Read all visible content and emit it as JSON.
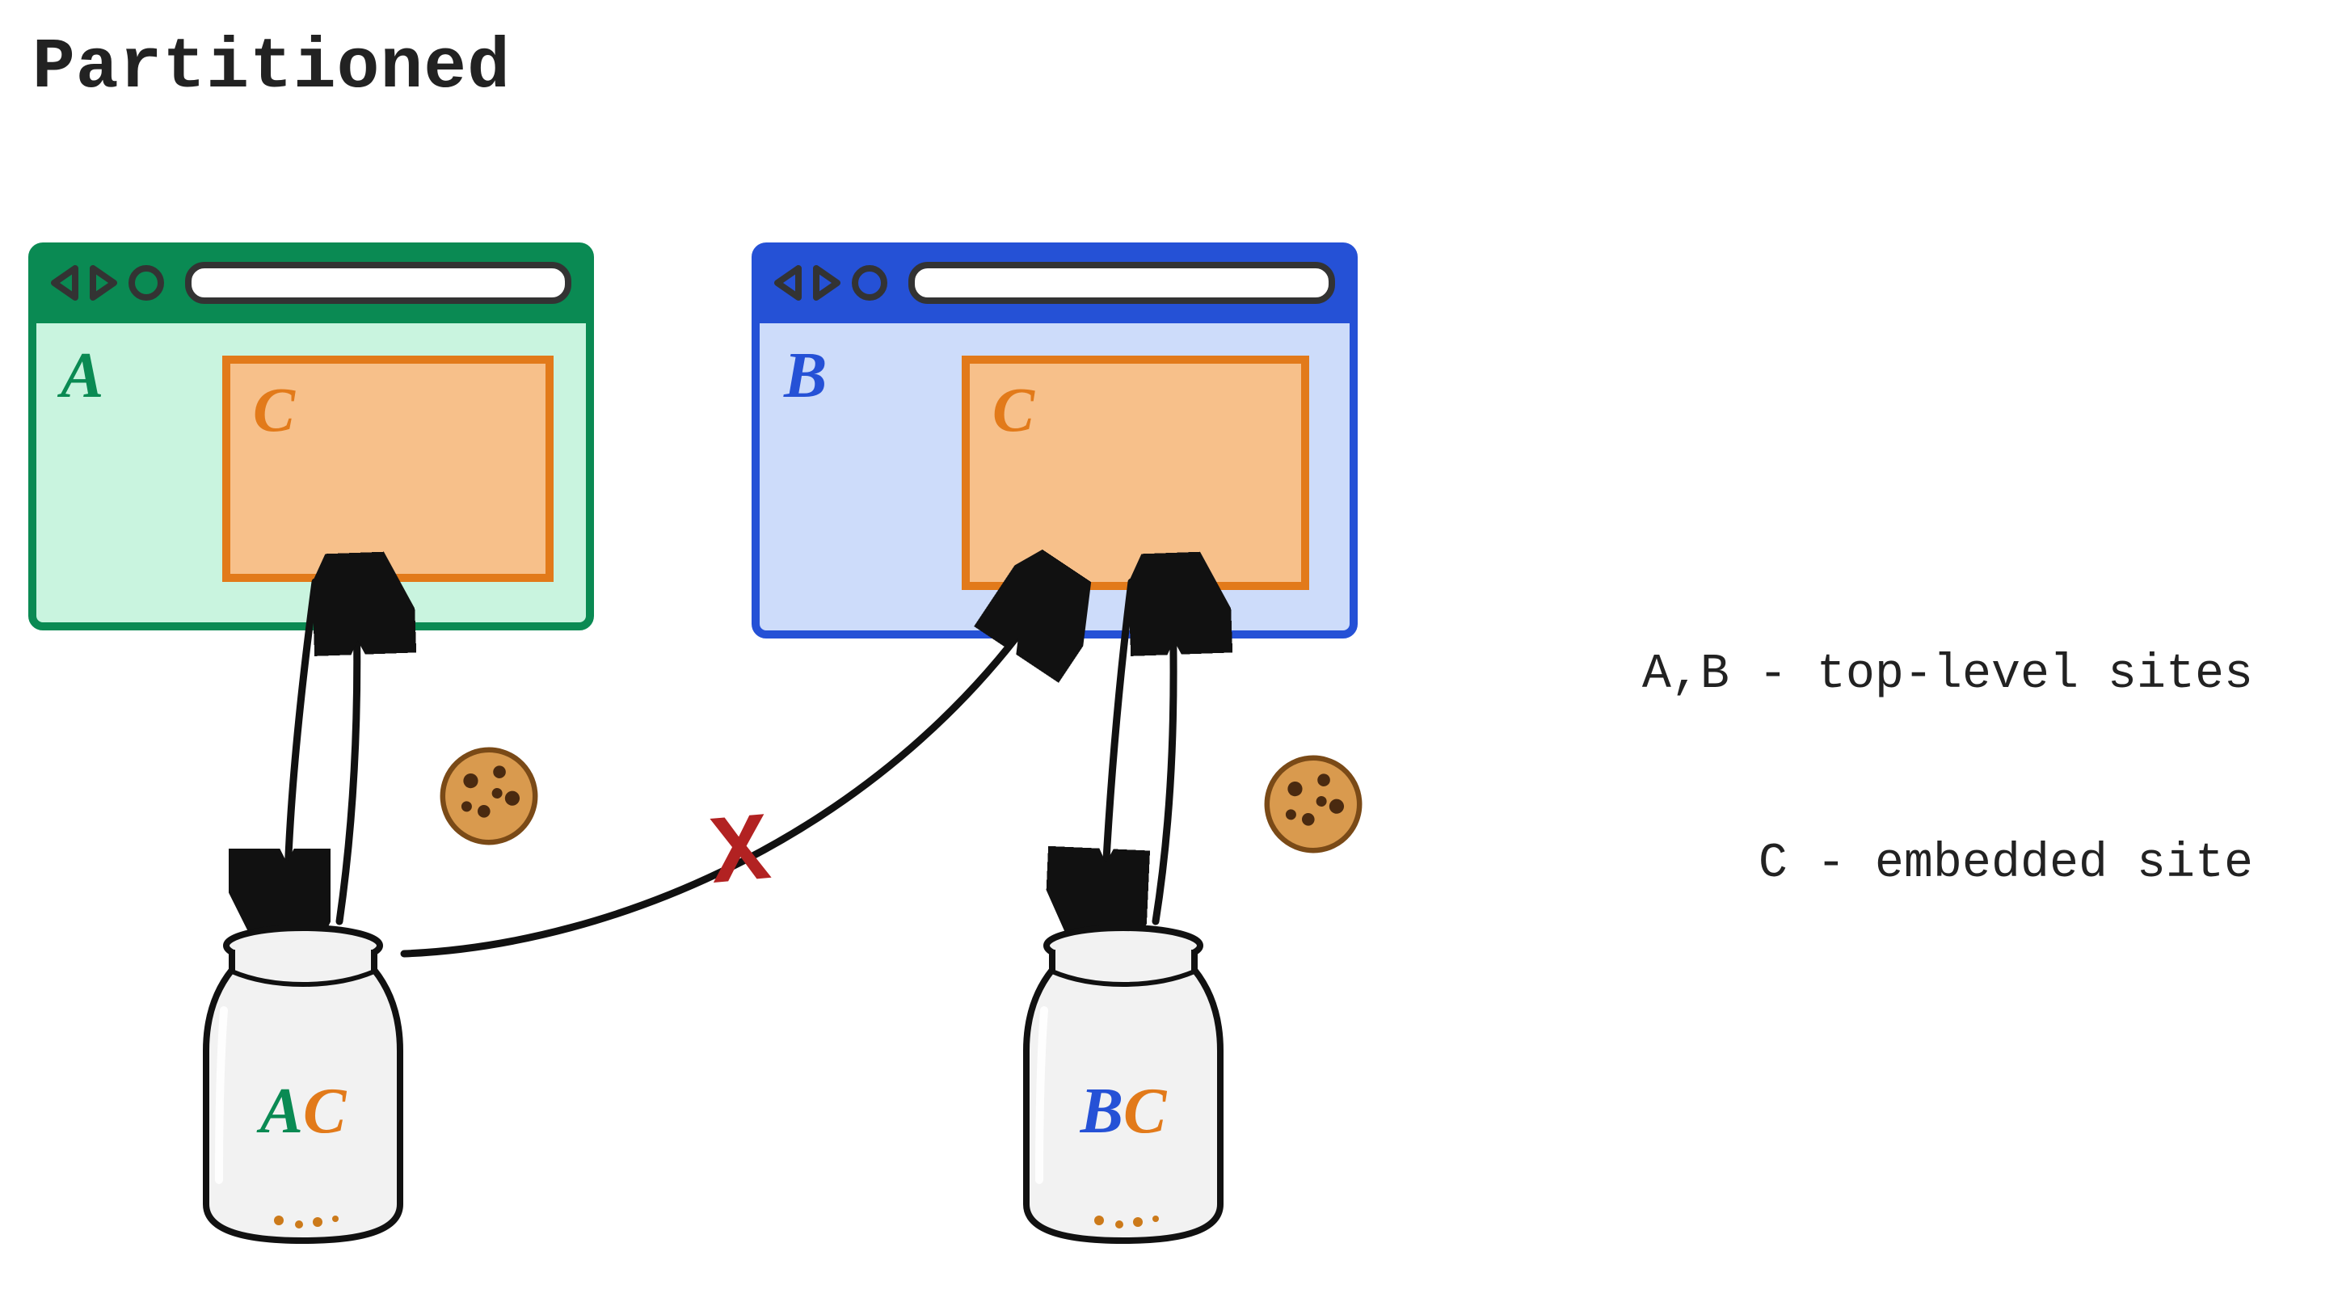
{
  "title": "Partitioned",
  "legend": {
    "line1": "A,B - top-level sites",
    "line2": "C - embedded site"
  },
  "sites": {
    "a": {
      "label": "A",
      "embedLabel": "C",
      "color": "#0a8a53",
      "bg": "#c9f4df"
    },
    "b": {
      "label": "B",
      "embedLabel": "C",
      "color": "#2551d6",
      "bg": "#cddcfa"
    }
  },
  "jars": {
    "left": {
      "labelA": "A",
      "labelC": "C"
    },
    "right": {
      "labelB": "B",
      "labelC": "C"
    }
  },
  "blockedAccess": {
    "symbol": "X",
    "meaning": "jar-AC cannot reach iframe C on site B"
  }
}
